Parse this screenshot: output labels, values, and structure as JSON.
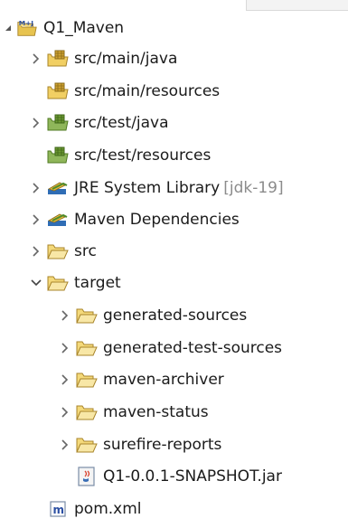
{
  "tree": {
    "project": {
      "label": "Q1_Maven",
      "badge": "M+J"
    },
    "items": [
      {
        "label": "src/main/java"
      },
      {
        "label": "src/main/resources"
      },
      {
        "label": "src/test/java"
      },
      {
        "label": "src/test/resources"
      },
      {
        "label": "JRE System Library",
        "decoration": "[jdk-19]"
      },
      {
        "label": "Maven Dependencies"
      },
      {
        "label": "src"
      },
      {
        "label": "target"
      },
      {
        "label": "generated-sources"
      },
      {
        "label": "generated-test-sources"
      },
      {
        "label": "maven-archiver"
      },
      {
        "label": "maven-status"
      },
      {
        "label": "surefire-reports"
      },
      {
        "label": "Q1-0.0.1-SNAPSHOT.jar"
      },
      {
        "label": "pom.xml"
      }
    ]
  },
  "icons": {
    "package_folder_color": "#c9a227",
    "test_folder_color": "#5a8f2a",
    "folder_color": "#e7c34f",
    "library_book_color": "#3b6fb6",
    "maven_m_color": "#2b4fa3"
  }
}
